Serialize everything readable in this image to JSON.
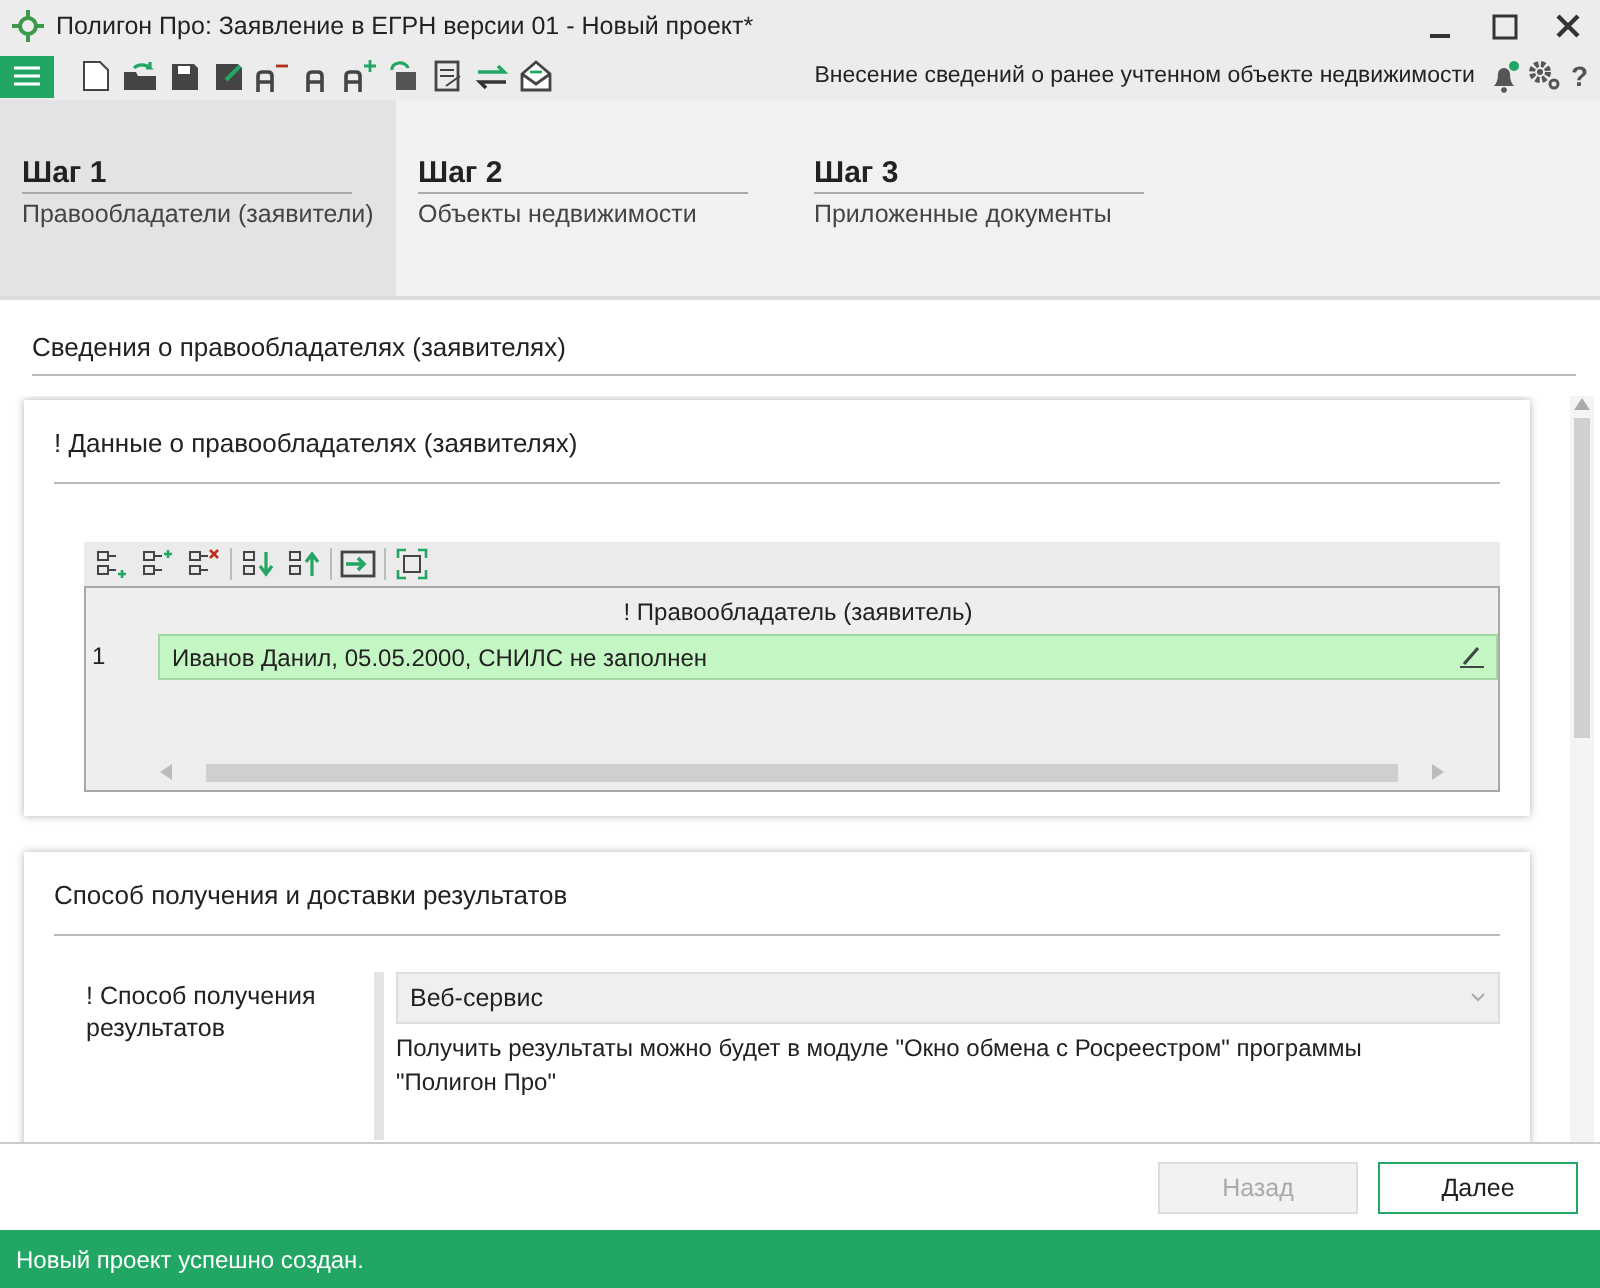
{
  "window": {
    "title": "Полигон Про: Заявление в ЕГРН версии 01 - Новый проект*"
  },
  "toolbar": {
    "caption": "Внесение сведений о ранее учтенном объекте недвижимости",
    "notification": true,
    "help": "?"
  },
  "steps": [
    {
      "number": "Шаг 1",
      "label": "Правообладатели (заявители)",
      "selected": true
    },
    {
      "number": "Шаг 2",
      "label": "Объекты недвижимости",
      "selected": false
    },
    {
      "number": "Шаг 3",
      "label": "Приложенные документы",
      "selected": false
    }
  ],
  "section_title": "Сведения о правообладателях (заявителях)",
  "holders_card": {
    "title": "! Данные о правообладателях (заявителях)",
    "table": {
      "columns": [
        "! Правообладатель (заявитель)"
      ],
      "rows": [
        {
          "number": "1",
          "cells": [
            "Иванов Данил, 05.05.2000, СНИЛС не заполнен"
          ],
          "selected": true
        }
      ]
    }
  },
  "delivery_card": {
    "title": "Способ получения и доставки результатов",
    "fields": [
      {
        "label": "! Способ получения результатов",
        "value": "Веб-сервис",
        "hint": "Получить результаты можно будет в модуле \"Окно обмена с Росреестром\" программы \"Полигон Про\""
      }
    ]
  },
  "buttons": [
    {
      "label": "Назад",
      "disabled": true
    },
    {
      "label": "Далее",
      "disabled": false
    }
  ],
  "status_bar": "Новый проект успешно создан."
}
